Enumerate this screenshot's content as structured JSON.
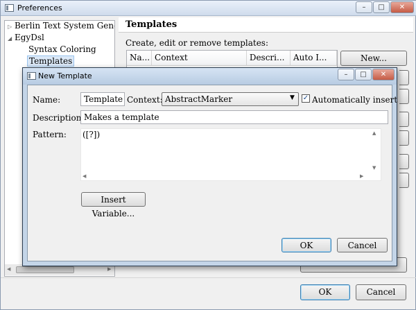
{
  "preferences": {
    "title": "Preferences",
    "tree": {
      "items": [
        {
          "label": "Berlin Text System Genera"
        },
        {
          "label": "EgyDsl"
        },
        {
          "label": "Syntax Coloring"
        },
        {
          "label": "Templates"
        }
      ]
    },
    "page": {
      "title": "Templates",
      "description": "Create, edit or remove templates:",
      "columns": [
        "Na...",
        "Context",
        "Descri...",
        "Auto I..."
      ],
      "new_button": "New..."
    },
    "ok_button": "OK",
    "cancel_button": "Cancel"
  },
  "dialog": {
    "title": "New Template",
    "name_label": "Name:",
    "name_value": "Template",
    "context_label": "Context:",
    "context_value": "AbstractMarker",
    "auto_insert_label": "Automatically insert",
    "auto_insert_checked": true,
    "description_label": "Description:",
    "description_value": "Makes a template",
    "pattern_label": "Pattern:",
    "pattern_value": "([?])",
    "insert_variable_button": "Insert Variable...",
    "ok_button": "OK",
    "cancel_button": "Cancel"
  }
}
